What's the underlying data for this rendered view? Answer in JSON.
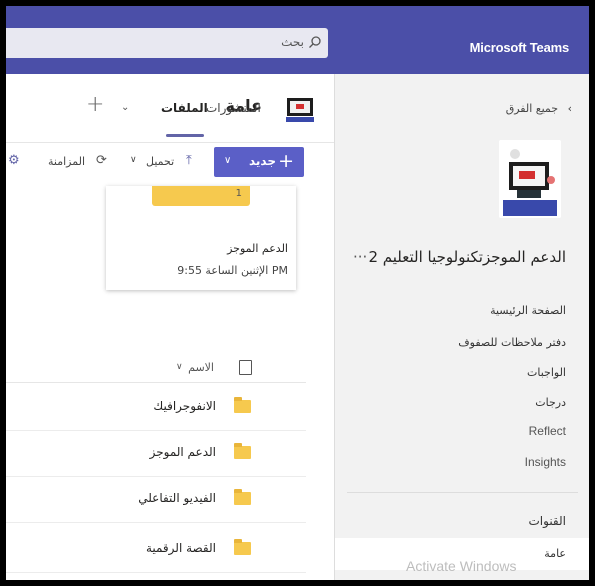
{
  "app": {
    "name": "Microsoft Teams",
    "accent": "#4b4fa8"
  },
  "search": {
    "label": "بحث",
    "icon": "search-icon"
  },
  "sidebar": {
    "back_label": "جميع الفرق",
    "team_title": "الدعم الموجزتكنولوجيا التعليم 2",
    "more_icon": "more-icon",
    "items": [
      {
        "label": "الصفحة الرئيسية"
      },
      {
        "label": "دفتر ملاحظات للصفوف"
      },
      {
        "label": "الواجبات"
      },
      {
        "label": "درجات"
      },
      {
        "label": "Reflect"
      },
      {
        "label": "Insights"
      }
    ],
    "channels_label": "القنوات",
    "selected_channel": "عامة"
  },
  "header": {
    "channel_name": "عامة",
    "tabs": [
      {
        "label": "المنشورات"
      },
      {
        "label": "الملفات"
      }
    ],
    "add_tab": "+"
  },
  "toolbar": {
    "new_label": "جديد",
    "upload_label": "تحميل",
    "sync_label": "المزامنة"
  },
  "card": {
    "thumb_badge": "1",
    "title": "الدعم الموجز",
    "subtitle": "الإثنين الساعة 9:55 PM"
  },
  "files": {
    "name_header": "الاسم",
    "rows": [
      {
        "label": "الانفوجرافيك"
      },
      {
        "label": "الدعم الموجز"
      },
      {
        "label": "الفيديو التفاعلي"
      },
      {
        "label": "القصة الرقمية"
      }
    ]
  },
  "watermark": "Activate Windows"
}
